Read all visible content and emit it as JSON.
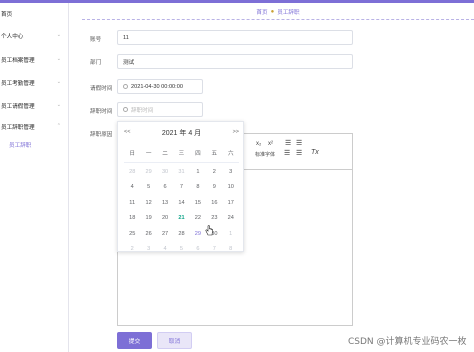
{
  "sidebar": {
    "items": [
      {
        "label": "首页"
      },
      {
        "label": "个人中心"
      },
      {
        "label": "员工档案管理"
      },
      {
        "label": "员工考勤管理"
      },
      {
        "label": "员工请假管理"
      },
      {
        "label": "员工辞职管理"
      }
    ],
    "active_sub": "员工辞职"
  },
  "breadcrumb": {
    "home": "首页",
    "current": "员工辞职"
  },
  "form": {
    "account_label": "账号",
    "account_value": "11",
    "dept_label": "部门",
    "dept_value": "测试",
    "apply_time_label": "请假时间",
    "apply_time_value": "2021-04-30 00:00:00",
    "resign_time_label": "辞职时间",
    "resign_time_placeholder": "辞职时间",
    "reason_label": "辞职原因"
  },
  "editor": {
    "sub_label": "x₂",
    "sup_label": "x²",
    "font_label": "标准字体",
    "clear_label": "Tx"
  },
  "datepicker": {
    "prev_label": "<<",
    "next_label": ">>",
    "year_label": "2021 年",
    "month_label": "4 月",
    "weekdays": [
      "日",
      "一",
      "二",
      "三",
      "四",
      "五",
      "六"
    ],
    "rows": [
      [
        "28",
        "29",
        "30",
        "31",
        "1",
        "2",
        "3"
      ],
      [
        "4",
        "5",
        "6",
        "7",
        "8",
        "9",
        "10"
      ],
      [
        "11",
        "12",
        "13",
        "14",
        "15",
        "16",
        "17"
      ],
      [
        "18",
        "19",
        "20",
        "21",
        "22",
        "23",
        "24"
      ],
      [
        "25",
        "26",
        "27",
        "28",
        "29",
        "30",
        "1"
      ],
      [
        "2",
        "3",
        "4",
        "5",
        "6",
        "7",
        "8"
      ]
    ]
  },
  "buttons": {
    "submit": "提交",
    "cancel": "取消"
  },
  "watermark": "CSDN @计算机专业码农一枚",
  "colors": {
    "accent": "#7d6fd6",
    "today": "#11a58a"
  }
}
